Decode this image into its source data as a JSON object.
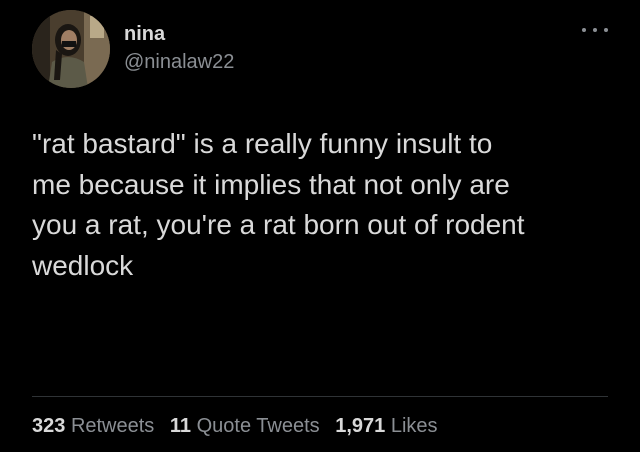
{
  "author": {
    "display_name": "nina",
    "handle": "@ninalaw22"
  },
  "tweet": {
    "text": "\"rat bastard\" is a really funny insult to\nme because it implies that not only are\nyou a rat, you're a rat born out of rodent\nwedlock"
  },
  "stats": {
    "retweets_count": "323",
    "retweets_label": "Retweets",
    "quotes_count": "11",
    "quotes_label": "Quote Tweets",
    "likes_count": "1,971",
    "likes_label": "Likes"
  },
  "icons": {
    "more": "more-dots-icon"
  },
  "colors": {
    "background": "#000000",
    "primary_text": "#d9d9d9",
    "secondary_text": "#8b8f94",
    "divider": "#2f3336"
  }
}
